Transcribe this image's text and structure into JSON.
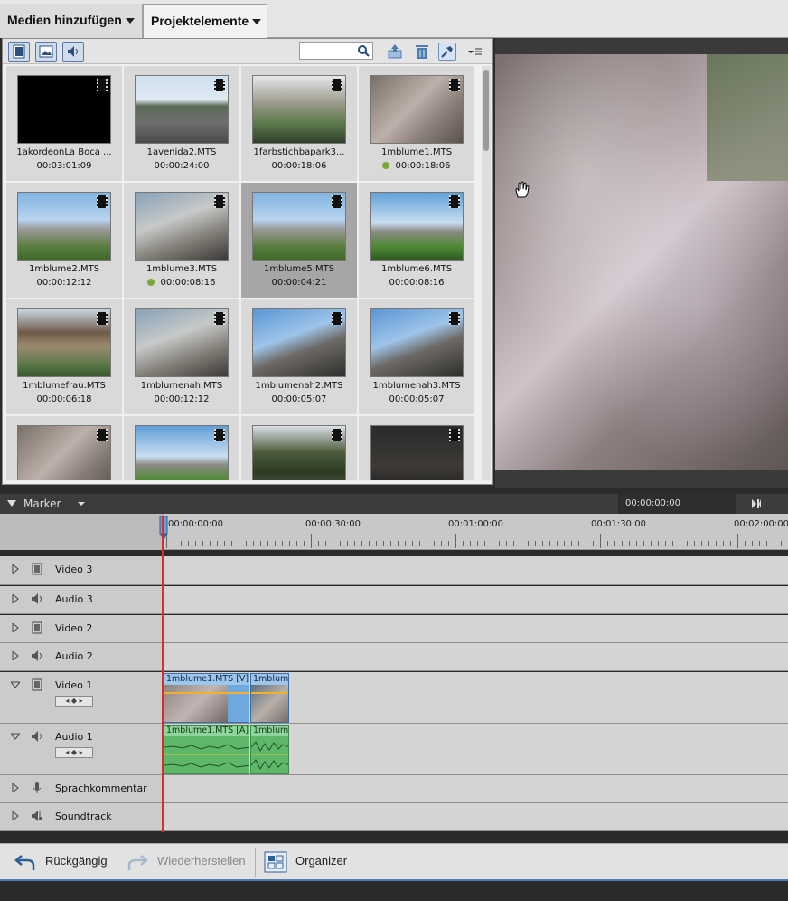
{
  "tabs": {
    "add_media": "Medien hinzufügen",
    "project_assets": "Projektelemente"
  },
  "search": {
    "placeholder": "",
    "value": ""
  },
  "assets": [
    {
      "name": "1akordeonLa Boca ...",
      "duration": "00:03:01:09",
      "dot": false,
      "selected": false,
      "thumb": "black"
    },
    {
      "name": "1avenida2.MTS",
      "duration": "00:00:24:00",
      "dot": false,
      "selected": false,
      "thumb": "street"
    },
    {
      "name": "1farbstichbapark3...",
      "duration": "00:00:18:06",
      "dot": false,
      "selected": false,
      "thumb": "park"
    },
    {
      "name": "1mblume1.MTS",
      "duration": "00:00:18:06",
      "dot": true,
      "selected": false,
      "thumb": "metal"
    },
    {
      "name": "1mblume2.MTS",
      "duration": "00:00:12:12",
      "dot": false,
      "selected": false,
      "thumb": "flower"
    },
    {
      "name": "1mblume3.MTS",
      "duration": "00:00:08:16",
      "dot": true,
      "selected": false,
      "thumb": "metal2"
    },
    {
      "name": "1mblume5.MTS",
      "duration": "00:00:04:21",
      "dot": false,
      "selected": true,
      "thumb": "flower"
    },
    {
      "name": "1mblume6.MTS",
      "duration": "00:00:08:16",
      "dot": false,
      "selected": false,
      "thumb": "flower2"
    },
    {
      "name": "1mblumefrau.MTS",
      "duration": "00:00:06:18",
      "dot": false,
      "selected": false,
      "thumb": "petal"
    },
    {
      "name": "1mblumenah.MTS",
      "duration": "00:00:12:12",
      "dot": false,
      "selected": false,
      "thumb": "metal2"
    },
    {
      "name": "1mblumenah2.MTS",
      "duration": "00:00:05:07",
      "dot": false,
      "selected": false,
      "thumb": "petal2"
    },
    {
      "name": "1mblumenah3.MTS",
      "duration": "00:00:05:07",
      "dot": false,
      "selected": false,
      "thumb": "petal2"
    },
    {
      "name": "",
      "duration": "",
      "dot": false,
      "selected": false,
      "thumb": "metal"
    },
    {
      "name": "",
      "duration": "",
      "dot": false,
      "selected": false,
      "thumb": "flower2"
    },
    {
      "name": "",
      "duration": "",
      "dot": false,
      "selected": false,
      "thumb": "trees"
    },
    {
      "name": "",
      "duration": "",
      "dot": false,
      "selected": false,
      "thumb": "dark"
    }
  ],
  "marker": {
    "label": "Marker",
    "timecode": "00:00:00:00"
  },
  "ruler": {
    "labels": [
      "00:00:00:00",
      "00:00:30:00",
      "00:01:00:00",
      "00:01:30:00",
      "00:02:00:00"
    ]
  },
  "tracks": [
    {
      "name": "Video 3",
      "type": "video",
      "expanded": false
    },
    {
      "name": "Audio 3",
      "type": "audio",
      "expanded": false
    },
    {
      "name": "Video 2",
      "type": "video",
      "expanded": false
    },
    {
      "name": "Audio 2",
      "type": "audio",
      "expanded": false
    },
    {
      "name": "Video 1",
      "type": "video",
      "expanded": true
    },
    {
      "name": "Audio 1",
      "type": "audio",
      "expanded": true
    },
    {
      "name": "Sprachkommentar",
      "type": "mic",
      "expanded": false
    },
    {
      "name": "Soundtrack",
      "type": "music",
      "expanded": false
    }
  ],
  "clips": {
    "video1_a": "1mblume1.MTS [V]",
    "video1_b": "1mblum",
    "audio1_a": "1mblume1.MTS [A]",
    "audio1_b": "1mblum"
  },
  "bottom": {
    "undo": "Rückgängig",
    "redo": "Wiederherstellen",
    "organizer": "Organizer"
  }
}
